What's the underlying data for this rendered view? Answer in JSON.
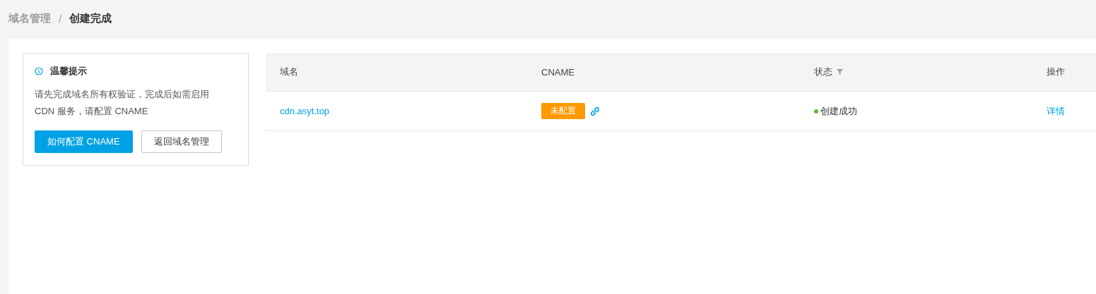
{
  "breadcrumb": [
    {
      "label": "域名管理",
      "selected": false
    },
    {
      "label": "/",
      "kind": "separator"
    },
    {
      "label": "创建完成",
      "selected": true
    }
  ],
  "tip": {
    "title": "温馨提示",
    "text": "请先完成域名所有权验证，完成后如需启用 CDN 服务，请配置 CNAME",
    "buttons": [
      {
        "label": "如何配置 CNAME",
        "kind": "primary"
      },
      {
        "label": "返回域名管理",
        "kind": "default"
      }
    ]
  },
  "table": {
    "columns": [
      {
        "label": "域名",
        "filter": false
      },
      {
        "label": "CNAME",
        "filter": false
      },
      {
        "label": "状态",
        "filter": true
      },
      {
        "label": "操作",
        "filter": false
      }
    ],
    "rows": [
      {
        "domain": "cdn.asyt.top",
        "cname_tag": {
          "label": "未配置",
          "color": "#ff9900"
        },
        "status": {
          "label": "创建成功",
          "color": "#5fb832"
        },
        "action": "详情"
      }
    ]
  }
}
